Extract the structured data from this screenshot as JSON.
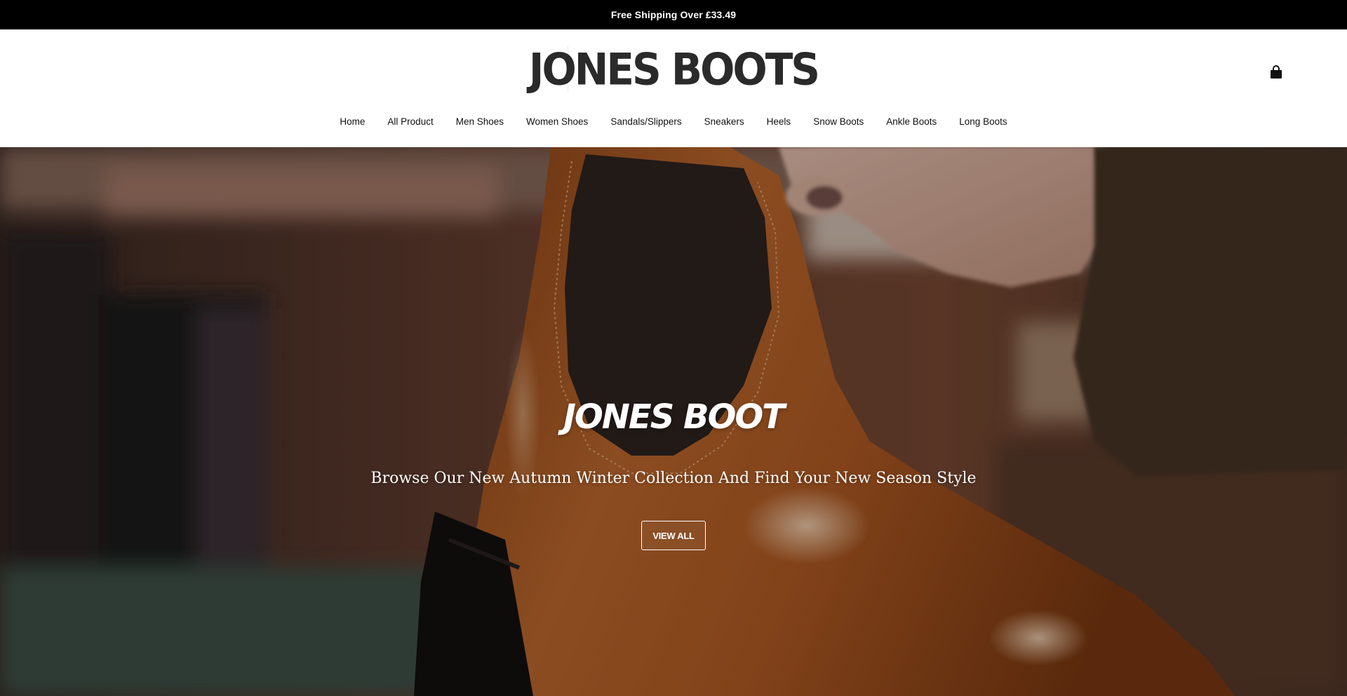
{
  "announcement": {
    "text": "Free Shipping Over £33.49"
  },
  "header": {
    "logo_text": "JONES BOOTS",
    "cart_icon": "shopping-bag-icon"
  },
  "nav": {
    "items": [
      {
        "label": "Home"
      },
      {
        "label": "All Product"
      },
      {
        "label": "Men Shoes"
      },
      {
        "label": "Women Shoes"
      },
      {
        "label": "Sandals/Slippers"
      },
      {
        "label": "Sneakers"
      },
      {
        "label": "Heels"
      },
      {
        "label": "Snow Boots"
      },
      {
        "label": "Ankle Boots"
      },
      {
        "label": "Long Boots"
      }
    ]
  },
  "hero": {
    "title": "JONES BOOT",
    "subtitle": "Browse Our New Autumn Winter Collection And Find Your New Season Style",
    "button_label": "VIEW ALL",
    "image": "leather-chelsea-ankle-boot-photo"
  },
  "colors": {
    "announcement_bg": "#000000",
    "header_bg": "#ffffff",
    "text_primary": "#111111",
    "logo": "#2a2a2a",
    "hero_text": "#ffffff",
    "boot_leather": "#b8622a"
  }
}
